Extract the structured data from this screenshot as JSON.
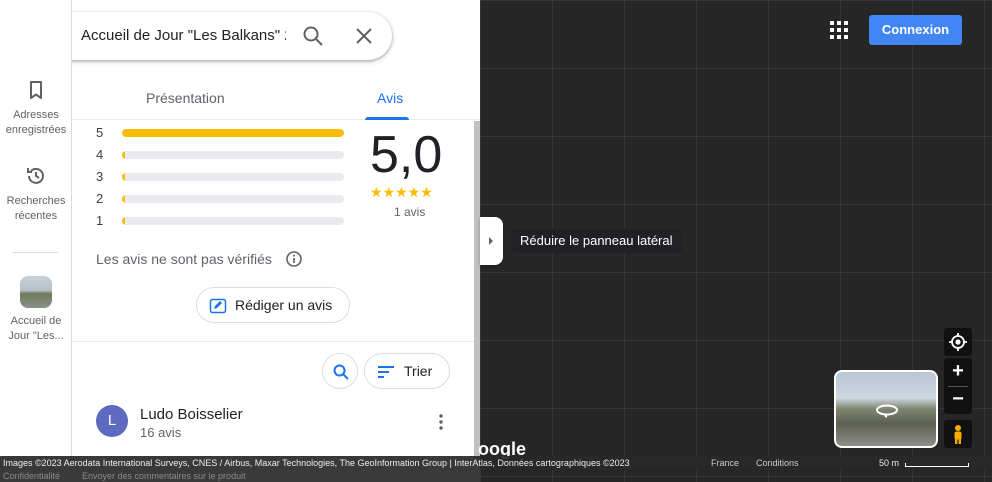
{
  "search": {
    "query": "Accueil de Jour \"Les Balkans\" 2"
  },
  "rail": {
    "saved": "Adresses enregistrées",
    "recent": "Recherches récentes",
    "place": "Accueil de Jour \"Les..."
  },
  "tabs": [
    "Présentation",
    "Avis"
  ],
  "ratings": {
    "histogram": [
      {
        "stars": "5",
        "fraction": 1.0
      },
      {
        "stars": "4",
        "fraction": 0.0
      },
      {
        "stars": "3",
        "fraction": 0.0
      },
      {
        "stars": "2",
        "fraction": 0.0
      },
      {
        "stars": "1",
        "fraction": 0.0
      }
    ],
    "score": "5,0",
    "stars": "★★★★★",
    "count": "1 avis",
    "unverified_note": "Les avis ne sont pas vérifiés",
    "write_label": "Rédiger un avis",
    "sort_label": "Trier"
  },
  "review": {
    "initial": "L",
    "name": "Ludo Boisselier",
    "sub": "16 avis"
  },
  "tooltip": "Réduire le panneau latéral",
  "header": {
    "login": "Connexion"
  },
  "map": {
    "google": "oogle"
  },
  "footer": {
    "attribution": "Images ©2023 Aerodata International Surveys, CNES / Airbus, Maxar Technologies, The GeoInformation Group | InterAtlas, Données cartographiques ©2023",
    "country": "France",
    "conditions": "Conditions",
    "scale": "50 m",
    "privacy": "Confidentialité",
    "feedback": "Envoyer des commentaires sur le produit"
  },
  "colors": {
    "accent": "#1a73e8",
    "star": "#fbbc04",
    "login": "#4285f4",
    "avatar": "#5c6bc0"
  }
}
